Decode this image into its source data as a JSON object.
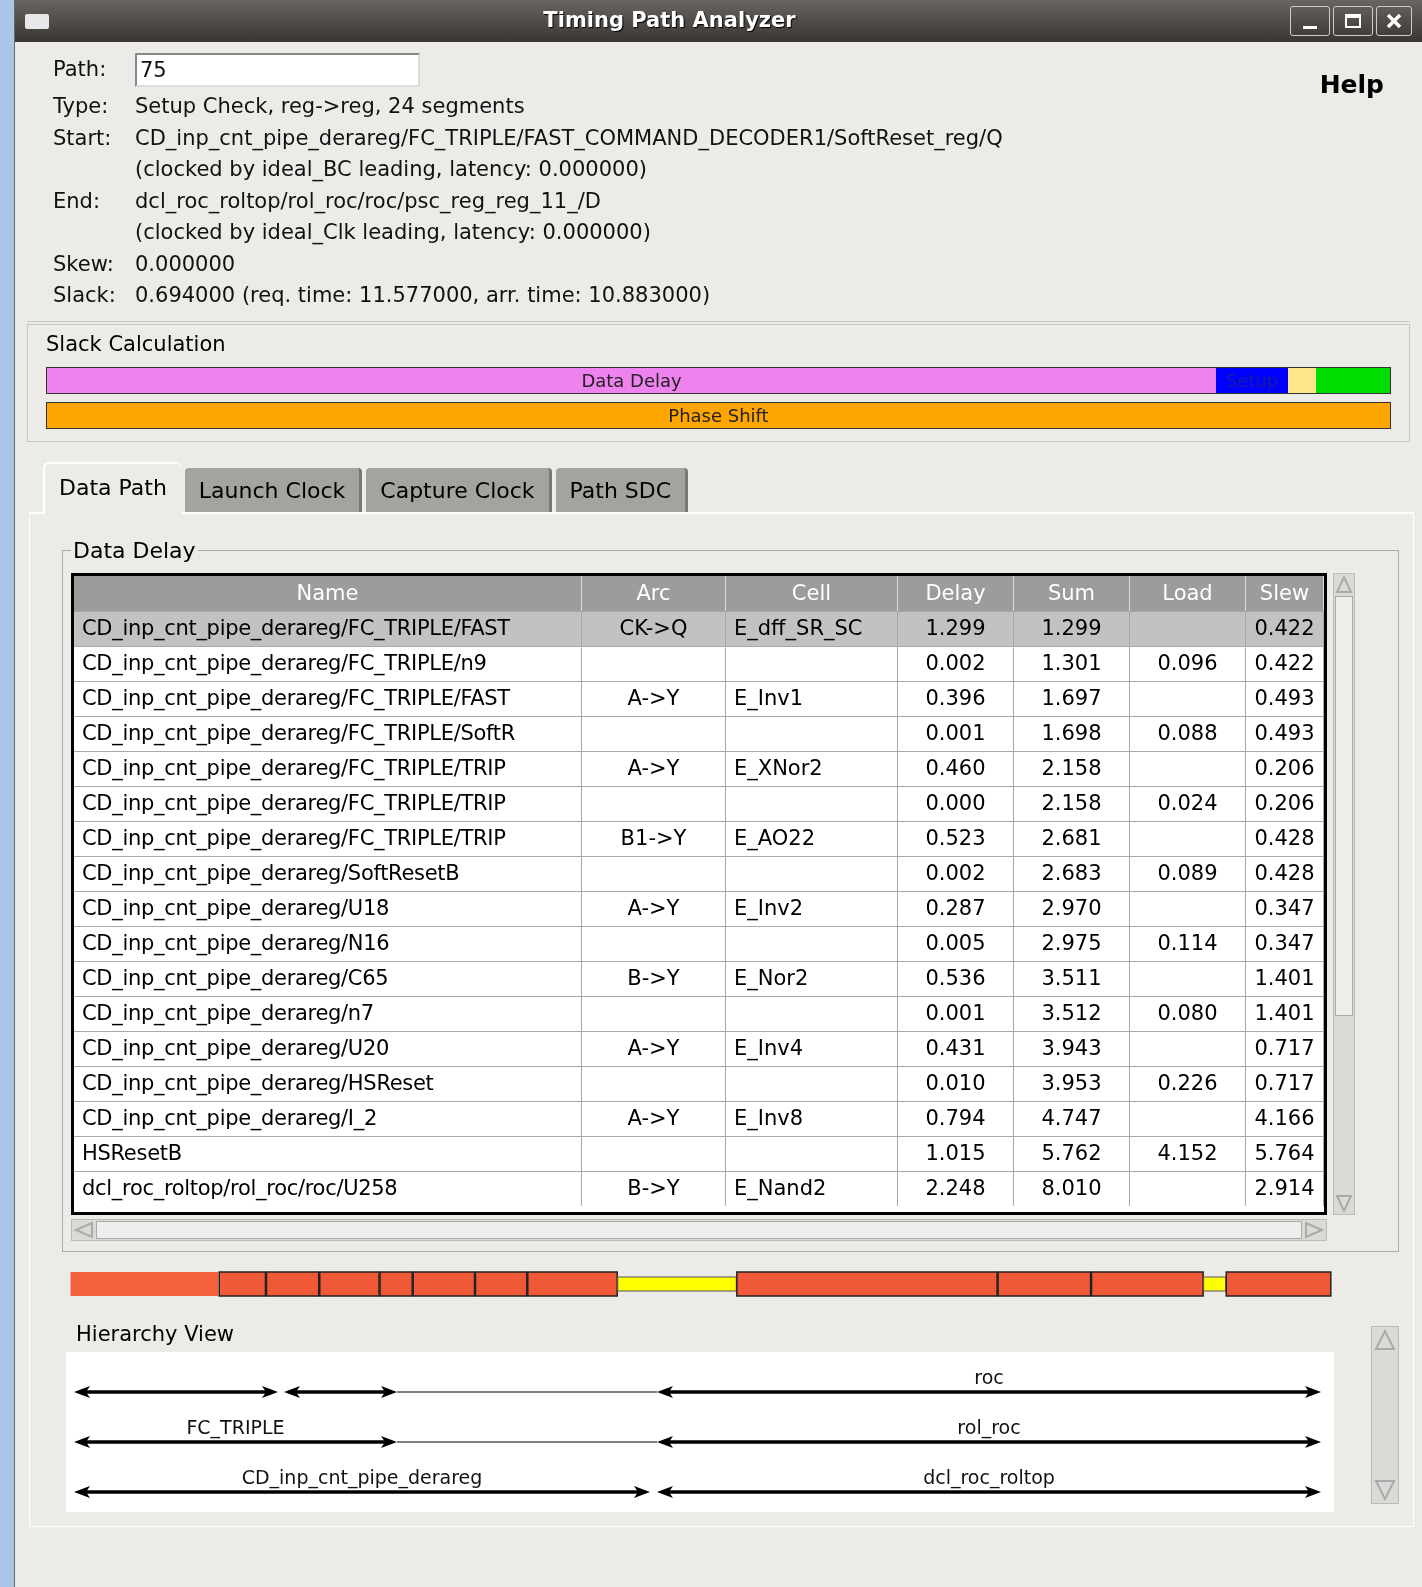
{
  "window": {
    "title": "Timing Path Analyzer"
  },
  "path": {
    "label": "Path:",
    "value": "75"
  },
  "help": "Help",
  "info": [
    {
      "label": "Type:",
      "lines": [
        "Setup Check, reg->reg, 24 segments"
      ]
    },
    {
      "label": "Start:",
      "lines": [
        "CD_inp_cnt_pipe_derareg/FC_TRIPLE/FAST_COMMAND_DECODER1/SoftReset_reg/Q",
        "(clocked by ideal_BC leading, latency: 0.000000)"
      ]
    },
    {
      "label": "End:",
      "lines": [
        "dcl_roc_roltop/rol_roc/roc/psc_reg_reg_11_/D",
        "(clocked by ideal_Clk leading, latency: 0.000000)"
      ]
    },
    {
      "label": "Skew:",
      "lines": [
        "0.000000"
      ]
    },
    {
      "label": "Slack:",
      "lines": [
        "0.694000 (req. time: 11.577000, arr. time: 10.883000)"
      ]
    }
  ],
  "slack_calculation": {
    "title": "Slack Calculation",
    "bars": [
      {
        "segments": [
          {
            "label": "Data Delay",
            "color": "#ee82ee"
          },
          {
            "label": "Setup",
            "color": "#0000ff"
          },
          {
            "color": "#ffe68c"
          },
          {
            "color": "#00dd00"
          }
        ]
      },
      {
        "segments": [
          {
            "label": "Phase Shift",
            "color": "#ffa500"
          }
        ]
      }
    ]
  },
  "tabs": [
    {
      "label": "Data Path",
      "selected": true
    },
    {
      "label": "Launch Clock",
      "selected": false
    },
    {
      "label": "Capture Clock",
      "selected": false
    },
    {
      "label": "Path SDC",
      "selected": false
    }
  ],
  "data_delay": {
    "title": "Data Delay",
    "columns": [
      "Name",
      "Arc",
      "Cell",
      "Delay",
      "Sum",
      "Load",
      "Slew"
    ],
    "rows": [
      {
        "selected": true,
        "cells": [
          "CD_inp_cnt_pipe_derareg/FC_TRIPLE/FAST",
          "CK->Q",
          "E_dff_SR_SC",
          "1.299",
          "1.299",
          "",
          "0.422"
        ]
      },
      {
        "selected": false,
        "cells": [
          "CD_inp_cnt_pipe_derareg/FC_TRIPLE/n9",
          "",
          "",
          "0.002",
          "1.301",
          "0.096",
          "0.422"
        ]
      },
      {
        "selected": false,
        "cells": [
          "CD_inp_cnt_pipe_derareg/FC_TRIPLE/FAST",
          "A->Y",
          "E_Inv1",
          "0.396",
          "1.697",
          "",
          "0.493"
        ]
      },
      {
        "selected": false,
        "cells": [
          "CD_inp_cnt_pipe_derareg/FC_TRIPLE/SoftR",
          "",
          "",
          "0.001",
          "1.698",
          "0.088",
          "0.493"
        ]
      },
      {
        "selected": false,
        "cells": [
          "CD_inp_cnt_pipe_derareg/FC_TRIPLE/TRIP",
          "A->Y",
          "E_XNor2",
          "0.460",
          "2.158",
          "",
          "0.206"
        ]
      },
      {
        "selected": false,
        "cells": [
          "CD_inp_cnt_pipe_derareg/FC_TRIPLE/TRIP",
          "",
          "",
          "0.000",
          "2.158",
          "0.024",
          "0.206"
        ]
      },
      {
        "selected": false,
        "cells": [
          "CD_inp_cnt_pipe_derareg/FC_TRIPLE/TRIP",
          "B1->Y",
          "E_AO22",
          "0.523",
          "2.681",
          "",
          "0.428"
        ]
      },
      {
        "selected": false,
        "cells": [
          "CD_inp_cnt_pipe_derareg/SoftResetB",
          "",
          "",
          "0.002",
          "2.683",
          "0.089",
          "0.428"
        ]
      },
      {
        "selected": false,
        "cells": [
          "CD_inp_cnt_pipe_derareg/U18",
          "A->Y",
          "E_Inv2",
          "0.287",
          "2.970",
          "",
          "0.347"
        ]
      },
      {
        "selected": false,
        "cells": [
          "CD_inp_cnt_pipe_derareg/N16",
          "",
          "",
          "0.005",
          "2.975",
          "0.114",
          "0.347"
        ]
      },
      {
        "selected": false,
        "cells": [
          "CD_inp_cnt_pipe_derareg/C65",
          "B->Y",
          "E_Nor2",
          "0.536",
          "3.511",
          "",
          "1.401"
        ]
      },
      {
        "selected": false,
        "cells": [
          "CD_inp_cnt_pipe_derareg/n7",
          "",
          "",
          "0.001",
          "3.512",
          "0.080",
          "1.401"
        ]
      },
      {
        "selected": false,
        "cells": [
          "CD_inp_cnt_pipe_derareg/U20",
          "A->Y",
          "E_Inv4",
          "0.431",
          "3.943",
          "",
          "0.717"
        ]
      },
      {
        "selected": false,
        "cells": [
          "CD_inp_cnt_pipe_derareg/HSReset",
          "",
          "",
          "0.010",
          "3.953",
          "0.226",
          "0.717"
        ]
      },
      {
        "selected": false,
        "cells": [
          "CD_inp_cnt_pipe_derareg/I_2",
          "A->Y",
          "E_Inv8",
          "0.794",
          "4.747",
          "",
          "4.166"
        ]
      },
      {
        "selected": false,
        "cells": [
          "HSResetB",
          "",
          "",
          "1.015",
          "5.762",
          "4.152",
          "5.764"
        ]
      },
      {
        "selected": false,
        "cells": [
          "dcl_roc_roltop/rol_roc/roc/U258",
          "B->Y",
          "E_Nand2",
          "2.248",
          "8.010",
          "",
          "2.914"
        ]
      }
    ]
  },
  "hierarchy_view": {
    "title": "Hierarchy View",
    "rows": [
      {
        "labels": [
          "roc"
        ]
      },
      {
        "labels": [
          "FC_TRIPLE",
          "rol_roc"
        ]
      },
      {
        "labels": [
          "CD_inp_cnt_pipe_derareg",
          "dcl_roc_roltop"
        ]
      }
    ]
  }
}
